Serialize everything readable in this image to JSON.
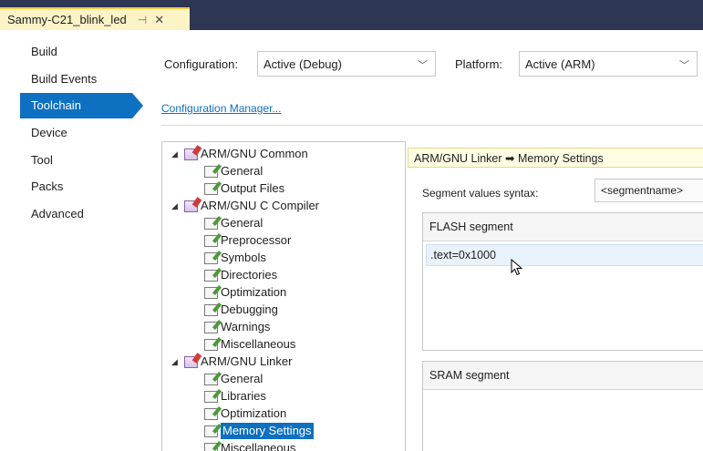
{
  "doc_tab": {
    "title": "Sammy-C21_blink_led",
    "pin": "⊣",
    "close": "✕"
  },
  "sidebar": {
    "items": [
      {
        "label": "Build"
      },
      {
        "label": "Build Events"
      },
      {
        "label": "Toolchain",
        "selected": true
      },
      {
        "label": "Device"
      },
      {
        "label": "Tool"
      },
      {
        "label": "Packs"
      },
      {
        "label": "Advanced"
      }
    ]
  },
  "config": {
    "configuration_label": "Configuration:",
    "configuration_value": "Active (Debug)",
    "platform_label": "Platform:",
    "platform_value": "Active (ARM)",
    "manager_link": "Configuration Manager..."
  },
  "tree": {
    "nodes": [
      {
        "label": "ARM/GNU Common",
        "level": 0,
        "expanded": true,
        "icon": "folder-icon"
      },
      {
        "label": "General",
        "level": 1,
        "icon": "page-icon"
      },
      {
        "label": "Output Files",
        "level": 1,
        "icon": "page-icon"
      },
      {
        "label": "ARM/GNU C Compiler",
        "level": 0,
        "expanded": true,
        "icon": "folder-icon"
      },
      {
        "label": "General",
        "level": 1,
        "icon": "page-icon"
      },
      {
        "label": "Preprocessor",
        "level": 1,
        "icon": "page-icon"
      },
      {
        "label": "Symbols",
        "level": 1,
        "icon": "page-icon"
      },
      {
        "label": "Directories",
        "level": 1,
        "icon": "page-icon"
      },
      {
        "label": "Optimization",
        "level": 1,
        "icon": "page-icon"
      },
      {
        "label": "Debugging",
        "level": 1,
        "icon": "page-icon"
      },
      {
        "label": "Warnings",
        "level": 1,
        "icon": "page-icon"
      },
      {
        "label": "Miscellaneous",
        "level": 1,
        "icon": "page-icon"
      },
      {
        "label": "ARM/GNU Linker",
        "level": 0,
        "expanded": true,
        "icon": "folder-icon"
      },
      {
        "label": "General",
        "level": 1,
        "icon": "page-icon"
      },
      {
        "label": "Libraries",
        "level": 1,
        "icon": "page-icon"
      },
      {
        "label": "Optimization",
        "level": 1,
        "icon": "page-icon"
      },
      {
        "label": "Memory Settings",
        "level": 1,
        "icon": "page-icon",
        "selected": true
      },
      {
        "label": "Miscellaneous",
        "level": 1,
        "icon": "page-icon"
      }
    ]
  },
  "panel": {
    "header": "ARM/GNU Linker ➡ Memory Settings",
    "syntax_label": "Segment values syntax:",
    "syntax_value": "<segmentname>",
    "flash_title": "FLASH segment",
    "flash_value": ".text=0x1000",
    "sram_title": "SRAM segment"
  },
  "colors": {
    "accent": "#0e70c0",
    "tabbar": "#2d3753",
    "tab_active": "#fcf3c7"
  }
}
